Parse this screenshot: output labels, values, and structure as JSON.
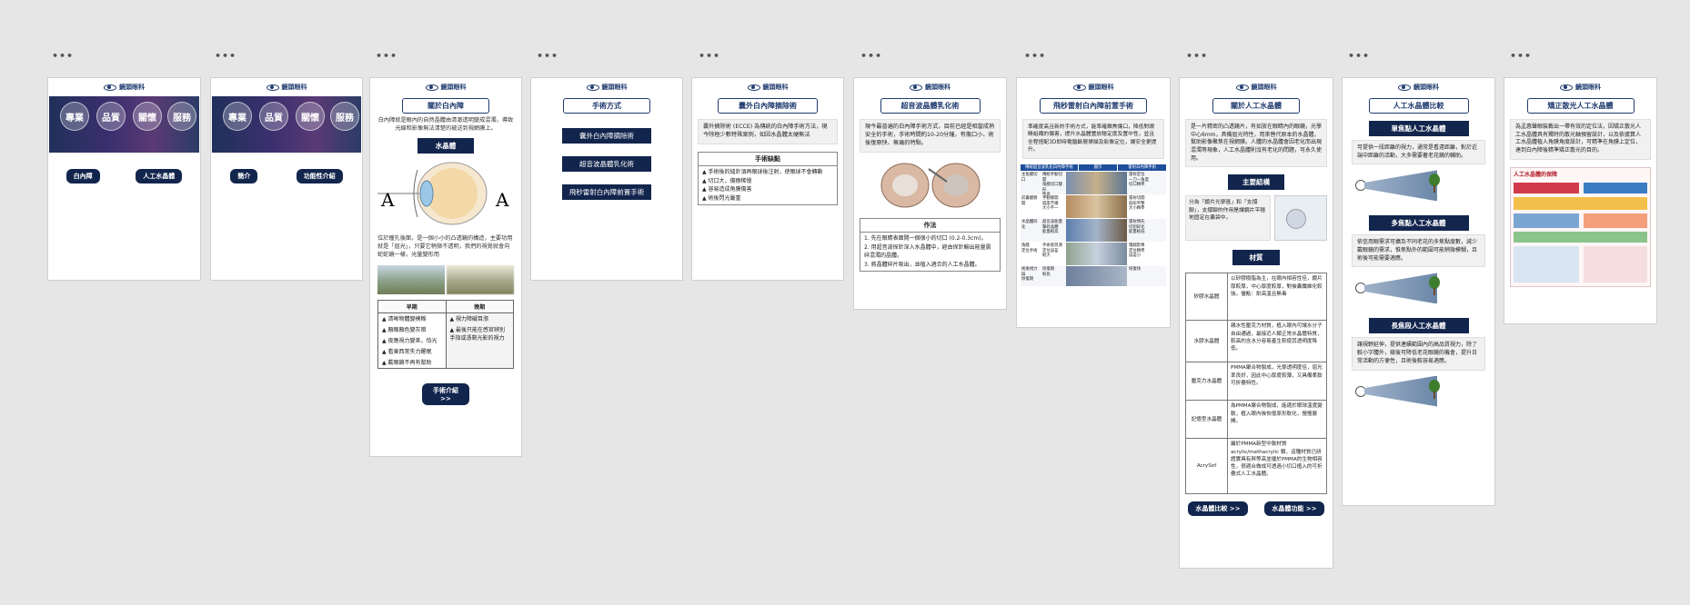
{
  "dots": "•••",
  "logo_text": "鏡頭眼科",
  "frames": {
    "f1": {
      "hero_words": [
        "專業",
        "品質",
        "關懷",
        "服務"
      ],
      "buttons": [
        "白內障",
        "人工水晶體"
      ]
    },
    "f2": {
      "hero_words": [
        "專業",
        "品質",
        "關懷",
        "服務"
      ],
      "buttons": [
        "簡介",
        "功能性介紹"
      ]
    },
    "f3": {
      "title": "關於白內障",
      "intro": "白內障就是眼內的自然晶體由清澈透明變成混濁，導致光線和影像無法清楚的被送到視網膜上。",
      "label": "水晶體",
      "desc": "位於瞳孔後面，是一個小小的凸透鏡的構造，主要功用就是「屈光」，只要它稍微不透明，我們的視覺就會向蛇蛇鏡一樣，光量變形而",
      "table_left_header": "早期",
      "table_right_header": "晚期",
      "early": [
        "▲ 清晰物體變模糊",
        "▲ 顏眼顏色變灰暗",
        "▲ 夜晚視力變差，怕光",
        "▲ 看東西常失力醒眠",
        "▲ 戴眼鏡不再有幫助"
      ],
      "late": [
        "▲ 視力障礙目漲",
        "▲ 最後只能在感官辨別手指或憑剩光影的視力"
      ],
      "button": "手術介紹 >>"
    },
    "f4": {
      "title": "手術方式",
      "items": [
        "囊外白內障摘除術",
        "超音波晶體乳化術",
        "飛秒雷射白內障前置手術"
      ]
    },
    "f5": {
      "title": "囊外白內障摘除術",
      "body": "囊外摘除術 (ECCE) 為傳統的白內障手術方法，現今除極少數特殊案例，如因水晶體太硬無法",
      "sub": "手術缺點",
      "cons": [
        "▲ 手術後的縫針須再眼球後注射，使眼球不會轉動",
        "▲ 切口大，傷療稀慢",
        "▲ 容易造成角膜傷害",
        "▲ 術後閃光嚴重"
      ]
    },
    "f6": {
      "title": "超音波晶體乳化術",
      "body": "現今最普遍的白內障手術方式，目前已經是相當成熟安全的手術，手術時間約10-20分鐘，有傷口小、術後復原快、無痛的特點。",
      "sub": "作法",
      "steps": [
        "1. 先在眼睛表面開一個很小的切口 (0.2-0.3cm)。",
        "2. 用超音波探針深入水晶體中，經由探針輸出能量震碎混濁的晶體。",
        "3. 將晶體碎片吸出，並植入適合的人工水晶體。"
      ]
    },
    "f7": {
      "title": "飛秒雷射白內障前置手術",
      "body": "準確度高且新的手術方式，能準確鎖焦傷口，降低對眼睛組織的傷害，提升水晶體置放穩定度及置中性，並且全程搭配3D即時電腦斷層掃描及影像定位，讓安全更提升。",
      "headers": [
        "傳統超音波乳化白內障手術",
        "圖示",
        "雷射白內障手術"
      ],
      "rows": [
        [
          "主角膜切口",
          "傳統手動切開\n角膜切口變形\n性高",
          "雷射定位\n一刀一角度\n切口精準"
        ],
        [
          "前囊膜撕開",
          "手動撕開\n圓度不穩\n大小不一",
          "雷射切開\n圓形平整\n大小精準"
        ],
        [
          "水晶體碎化",
          "超音波能量\n擊碎晶體\n能量較高",
          "雷射預先\n切割碎化\n能量較低"
        ],
        [
          "角膜\n定位手術",
          "手術者目測\n定位誤差\n較大",
          "電腦影像\n定位精準\n誤差小"
        ],
        [
          "術後視力與\n恢復期",
          "恢復期\n較長",
          "恢復快"
        ]
      ]
    },
    "f8": {
      "title": "關於人工水晶體",
      "intro": "是一片精密的凸透鏡片，有如放在眼睛內的眼鏡，光學中心6mm，具備屈光特性，用來替代原本的水晶體，幫助影像聚焦在視網膜。人體的水晶體會因老化而出現混濁等現象，人工水晶體則沒有老化的問題，可永久使用。",
      "sub1": "主要結構",
      "struct": "分為「鏡片光學區」和「支撐腳」，支撐腳的作用是讓鏡片平穩地固定在囊袋中。",
      "sub2": "材質",
      "materials": [
        {
          "name": "矽膠水晶體",
          "desc": "以矽膠樹脂為主，在眼內相容性佳，鏡片厚較厚，中心厚度較厚，對後囊纖維化較強。優點：耐高溫且無毒"
        },
        {
          "name": "水膠水晶體",
          "desc": "親水性壓克力材質，植入眼內可讓水分子自由通過，最接近人類正常水晶體特質，較高的含水分容易產生較使其透明度降低。"
        },
        {
          "name": "壓克力水晶體",
          "desc": "PMMA聚合物製成，光學透明度佳，屈光率良好，因此中心厚度較薄，又具備柔軟可折疊特性。"
        },
        {
          "name": "記憶型水晶體",
          "desc": "為PMMA聚合物製成，能適於眼球溫度變軟，植入眼內後恢復原形軟化，慢慢展開。"
        },
        {
          "name": "AcrySof",
          "desc": "屬於PMMA新型中軟材質acrylic/methacrylic 類，這種材質已研證實具有與等高並優於PMMA的生物相容性，很適合做成可透過小切口植入的可折疊式人工水晶體。"
        }
      ],
      "btn1": "水晶體比較 >>",
      "btn2": "水晶體功能 >>"
    },
    "f9": {
      "title": "人工水晶體比較",
      "s1": "單焦點人工水晶體",
      "s1_text": "可提供一段距離的視力，通常是看遠距離，對於近端中距離的活動，大多需要著老花鏡的輔助。",
      "s2": "多焦點人工水晶體",
      "s2_text": "依信用眼需求可擴及不同老花的多焦點度數，減少戴眼鏡的需求，惟焦點外的範圍可能稍微模糊，且術後可能需要適應。",
      "s3": "長焦段人工水晶體",
      "s3_text": "讓視野延伸，提供連續範圍內的高品質視力，除了較小字體外，幾後可降低老花眼鏡的機會，提升日常活動的方便性，且術後較容易適應。"
    },
    "f10": {
      "title": "矯正散光人工水晶體",
      "body": "為孟惠聲眼裝載出一帶有效的定位法，因矯正散光人工水晶體具有獨特的散光軸預留設計，以及依據算人工水晶體植入角膜角度設計，可精準在角膜上定位，達到白內障後精準矯正散光的目的。",
      "poster_title": "人工水晶體的保障"
    }
  }
}
